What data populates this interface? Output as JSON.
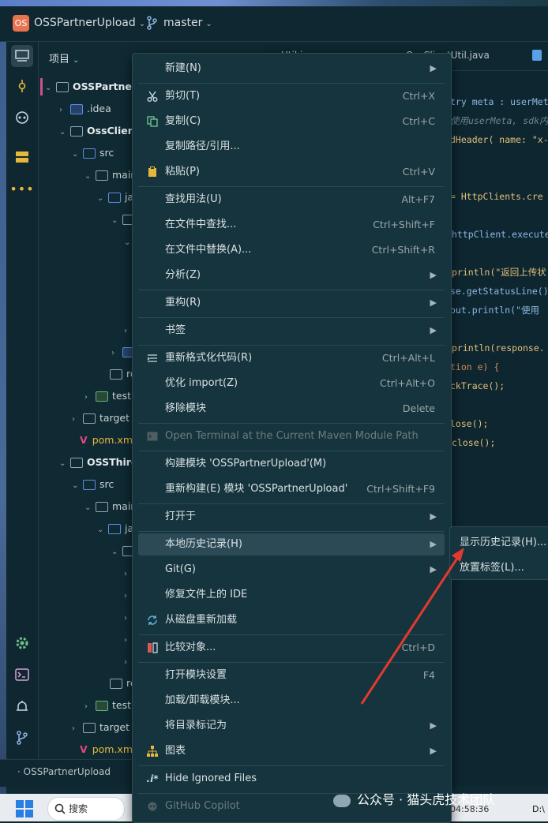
{
  "titlebar": {
    "badge": "OS",
    "project": "OSSPartnerUpload",
    "branch": "master"
  },
  "project_panel": {
    "title": "项目",
    "tree": [
      {
        "label": "OSSPartnerU",
        "bold": true
      },
      {
        "label": ".idea"
      },
      {
        "label": "OssClient",
        "bold": true
      },
      {
        "label": "src"
      },
      {
        "label": "main"
      },
      {
        "label": "ja"
      },
      {
        "label": "re"
      },
      {
        "label": "test"
      },
      {
        "label": "target"
      },
      {
        "label": "pom.xm"
      },
      {
        "label": "OSSThird",
        "bold": true
      },
      {
        "label": "src"
      },
      {
        "label": "main"
      },
      {
        "label": "ja"
      },
      {
        "label": "re"
      },
      {
        "label": "test"
      },
      {
        "label": "target"
      },
      {
        "label": "pom.xm"
      }
    ]
  },
  "status": {
    "breadcrumb": "OSSPartnerUpload"
  },
  "editor": {
    "tabs": [
      "Util.java",
      "OssClientUtil.java"
    ],
    "code": [
      "try meta : userMet",
      "使用userMeta, sdk内",
      "dHeader(  name: \"x-o",
      "= HttpClients.cre",
      "httpClient.execute",
      "println(\"返回上传状",
      "se.getStatusLine()",
      "out.println(\"使用",
      "println(response.",
      "tion e) {",
      "ckTrace();",
      "lose();",
      "close();"
    ]
  },
  "context_menu": {
    "items": [
      {
        "label": "新建(N)",
        "submenu": true
      },
      {
        "label": "剪切(T)",
        "shortcut": "Ctrl+X",
        "icon": "scissors-icon"
      },
      {
        "label": "复制(C)",
        "shortcut": "Ctrl+C",
        "icon": "copy-icon"
      },
      {
        "label": "复制路径/引用..."
      },
      {
        "label": "粘贴(P)",
        "shortcut": "Ctrl+V",
        "icon": "clipboard-icon"
      },
      {
        "label": "查找用法(U)",
        "shortcut": "Alt+F7"
      },
      {
        "label": "在文件中查找...",
        "shortcut": "Ctrl+Shift+F"
      },
      {
        "label": "在文件中替换(A)...",
        "shortcut": "Ctrl+Shift+R"
      },
      {
        "label": "分析(Z)",
        "submenu": true
      },
      {
        "label": "重构(R)",
        "submenu": true
      },
      {
        "label": "书签",
        "submenu": true
      },
      {
        "label": "重新格式化代码(R)",
        "shortcut": "Ctrl+Alt+L",
        "icon": "format-icon"
      },
      {
        "label": "优化 import(Z)",
        "shortcut": "Ctrl+Alt+O"
      },
      {
        "label": "移除模块",
        "shortcut": "Delete"
      },
      {
        "label": "Open Terminal at the Current Maven Module Path",
        "disabled": true,
        "icon": "terminal-icon"
      },
      {
        "label": "构建模块 'OSSPartnerUpload'(M)"
      },
      {
        "label": "重新构建(E) 模块 'OSSPartnerUpload'",
        "shortcut": "Ctrl+Shift+F9"
      },
      {
        "label": "打开于",
        "submenu": true
      },
      {
        "label": "本地历史记录(H)",
        "submenu": true
      },
      {
        "label": "Git(G)",
        "submenu": true
      },
      {
        "label": "修复文件上的 IDE"
      },
      {
        "label": "从磁盘重新加载",
        "icon": "reload-icon"
      },
      {
        "label": "比较对象...",
        "shortcut": "Ctrl+D",
        "icon": "compare-icon"
      },
      {
        "label": "打开模块设置",
        "shortcut": "F4"
      },
      {
        "label": "加载/卸载模块..."
      },
      {
        "label": "将目录标记为",
        "submenu": true
      },
      {
        "label": "图表",
        "submenu": true,
        "icon": "diagram-icon"
      },
      {
        "label": "Hide Ignored Files",
        "icon": "ignore-icon"
      },
      {
        "label": "GitHub Copilot",
        "disabled": true,
        "icon": "copilot-icon"
      }
    ]
  },
  "submenu": {
    "items": [
      "显示历史记录(H)...",
      "放置标签(L)..."
    ]
  },
  "taskbar": {
    "search_label": "搜索",
    "clock": "04:58:36",
    "drive": "D:\\"
  },
  "watermark": "公众号 · 猫头虎技术团队",
  "colors": {
    "accent_badge": "#e8734f",
    "menu_bg": "#16343d",
    "highlight": "#2b4a56",
    "arrow": "#e23a2f"
  }
}
